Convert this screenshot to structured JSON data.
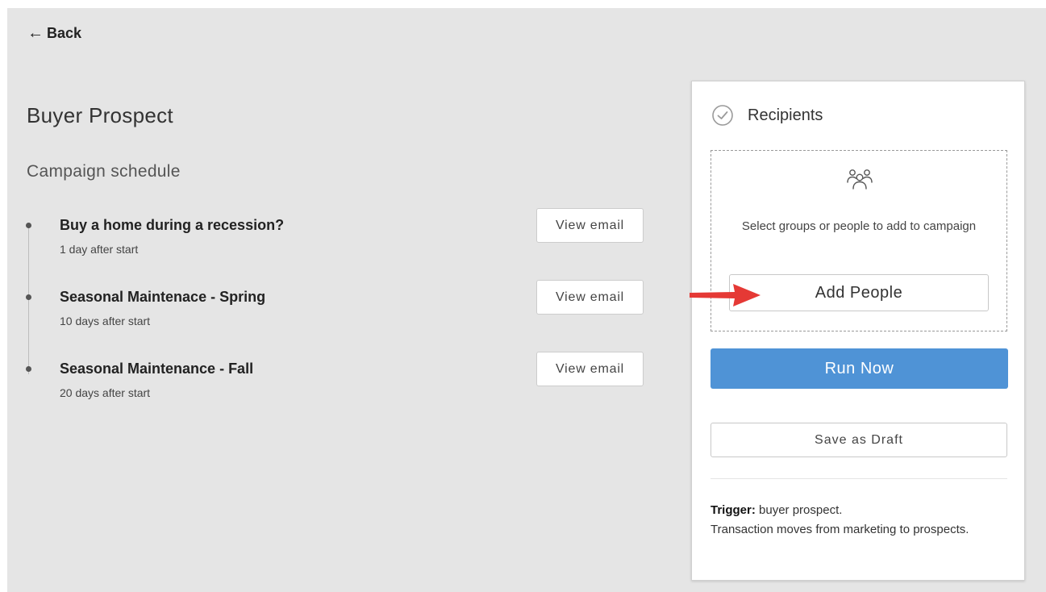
{
  "nav": {
    "back_arrow": "←",
    "back_label": "Back"
  },
  "campaign": {
    "title": "Buyer Prospect",
    "schedule_heading": "Campaign schedule",
    "steps": [
      {
        "title": "Buy a home during a recession?",
        "delay": "1 day after start",
        "button": "View email"
      },
      {
        "title": "Seasonal Maintenace - Spring",
        "delay": "10 days after start",
        "button": "View email"
      },
      {
        "title": "Seasonal Maintenance - Fall",
        "delay": "20 days after start",
        "button": "View email"
      }
    ]
  },
  "panel": {
    "title": "Recipients",
    "select_text": "Select groups or people to add to campaign",
    "add_people": "Add People",
    "run_now": "Run Now",
    "save_draft": "Save as Draft",
    "trigger_label": "Trigger:",
    "trigger_value": " buyer prospect.",
    "trigger_detail": "Transaction moves from marketing to prospects."
  },
  "icons": {
    "check": "check-circle-icon",
    "group": "group-icon",
    "annotation": "red-arrow-icon"
  },
  "colors": {
    "background": "#e5e5e5",
    "primary_button": "#4f93d6",
    "annotation_arrow": "#e53935"
  }
}
